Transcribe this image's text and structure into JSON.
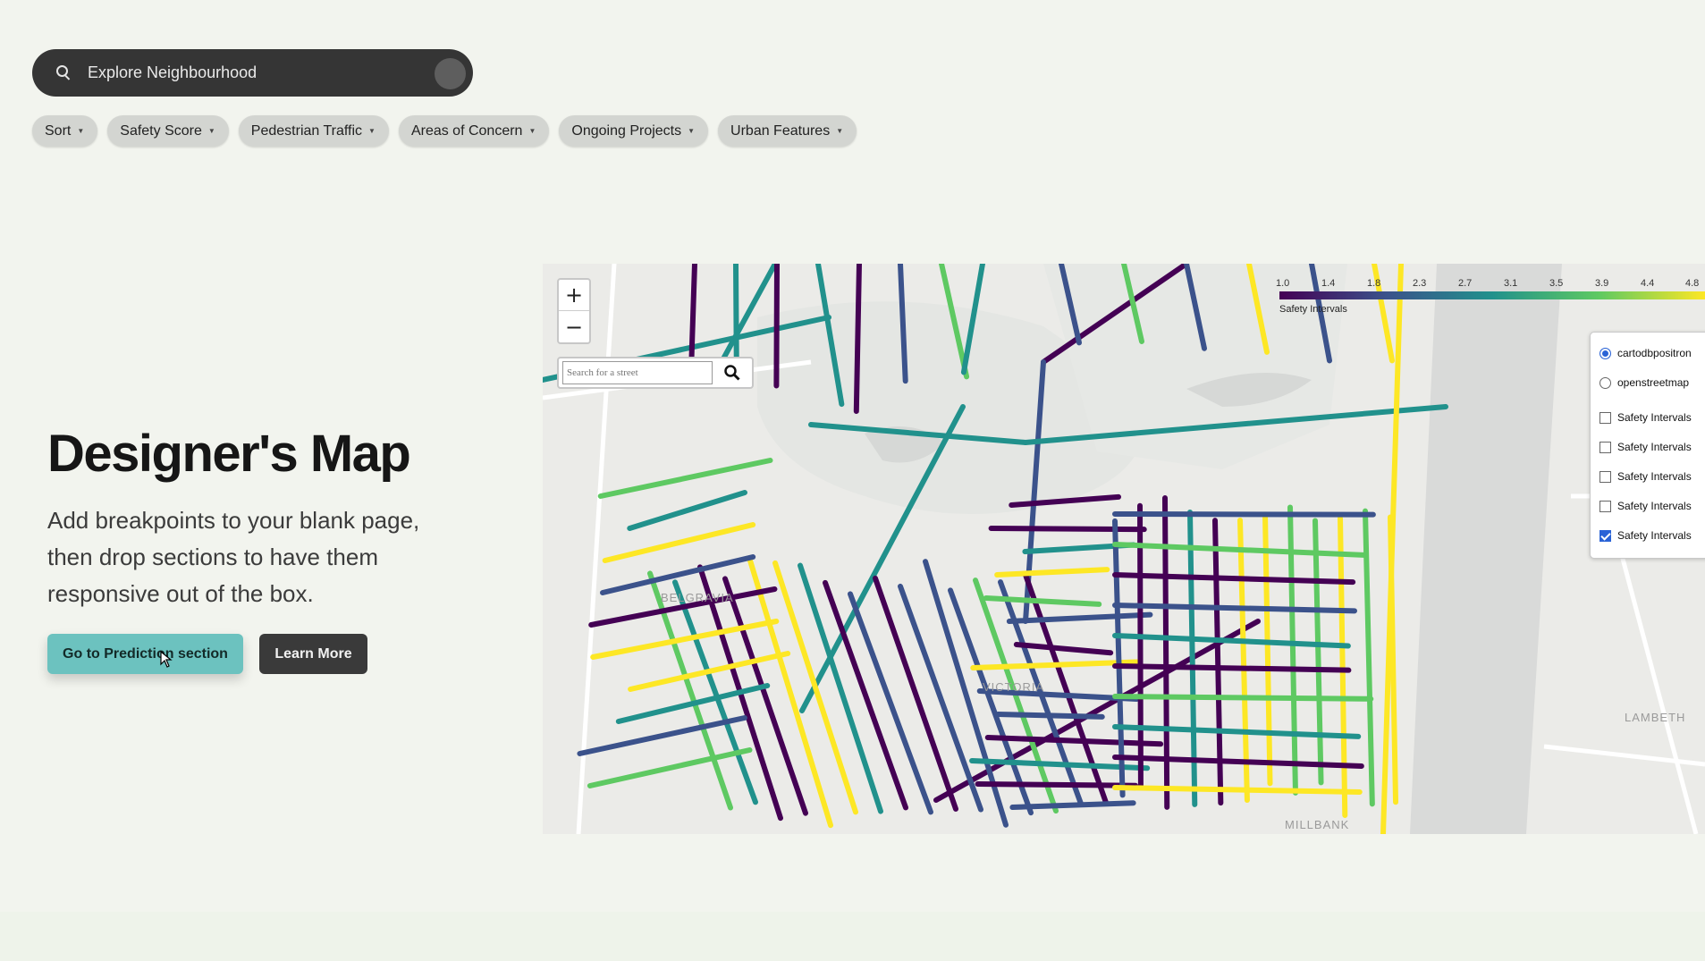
{
  "search": {
    "label": "Explore Neighbourhood"
  },
  "filters": [
    {
      "label": "Sort"
    },
    {
      "label": "Safety Score"
    },
    {
      "label": "Pedestrian Traffic"
    },
    {
      "label": "Areas of Concern"
    },
    {
      "label": "Ongoing Projects"
    },
    {
      "label": "Urban Features"
    }
  ],
  "hero": {
    "title": "Designer's Map",
    "description": "Add breakpoints to your blank page, then drop sections to have them responsive out of the box.",
    "primary_button": "Go to Prediction section",
    "secondary_button": "Learn More"
  },
  "map": {
    "zoom_in": "+",
    "zoom_out": "−",
    "street_search_placeholder": "Search for a street",
    "legend": {
      "label": "Safety Intervals",
      "ticks": [
        "1.0",
        "1.4",
        "1.8",
        "2.3",
        "2.7",
        "3.1",
        "3.5",
        "3.9",
        "4.4",
        "4.8"
      ],
      "colors": [
        "#440154",
        "#3b528b",
        "#21918c",
        "#5ec962",
        "#fde725"
      ]
    },
    "layers": {
      "base": [
        {
          "label": "cartodbpositron",
          "selected": true
        },
        {
          "label": "openstreetmap",
          "selected": false
        }
      ],
      "overlays": [
        {
          "label": "Safety Intervals",
          "checked": false
        },
        {
          "label": "Safety Intervals",
          "checked": false
        },
        {
          "label": "Safety Intervals",
          "checked": false
        },
        {
          "label": "Safety Intervals",
          "checked": false
        },
        {
          "label": "Safety Intervals",
          "checked": true
        }
      ]
    },
    "places": [
      "BELGRAVIA",
      "VICTORIA",
      "LAMBETH",
      "MILLBANK"
    ]
  }
}
